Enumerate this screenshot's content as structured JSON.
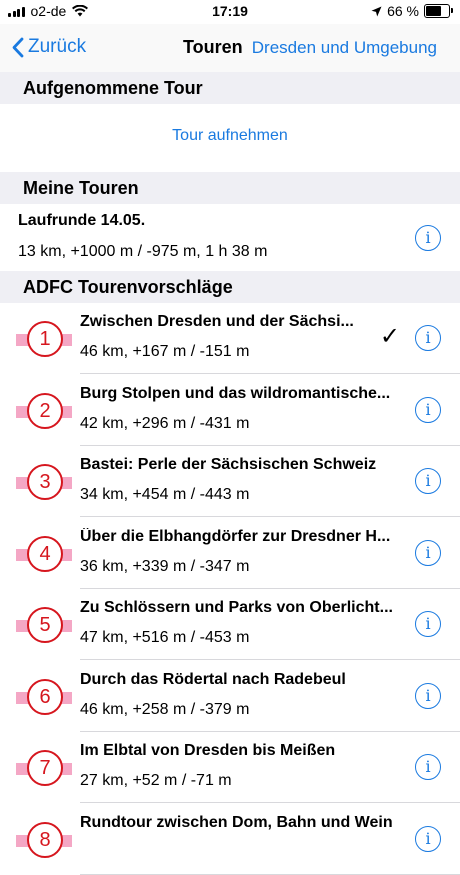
{
  "status_bar": {
    "carrier": "o2-de",
    "time": "17:19",
    "battery_text": "66 %",
    "battery_level": 0.66
  },
  "nav": {
    "back_label": "Zurück",
    "title": "Touren",
    "right_label": "Dresden und Umgebung"
  },
  "recorded_section": {
    "header": "Aufgenommene Tour",
    "record_label": "Tour aufnehmen"
  },
  "my_tours_section": {
    "header": "Meine Touren",
    "tours": [
      {
        "title": "Laufrunde 14.05.",
        "stats": "13 km, +1000 m / -975 m, 1 h 38 m"
      }
    ]
  },
  "adfc_section": {
    "header": "ADFC Tourenvorschläge",
    "tours": [
      {
        "number": "1",
        "title": "Zwischen Dresden und der Sächsi...",
        "stats": "46 km, +167 m / -151 m",
        "checked": true
      },
      {
        "number": "2",
        "title": "Burg Stolpen und das wildromantische...",
        "stats": "42 km, +296 m / -431 m",
        "checked": false
      },
      {
        "number": "3",
        "title": "Bastei: Perle der Sächsischen Schweiz",
        "stats": "34 km, +454 m / -443 m",
        "checked": false
      },
      {
        "number": "4",
        "title": "Über die Elbhangdörfer zur Dresdner H...",
        "stats": "36 km, +339 m / -347 m",
        "checked": false
      },
      {
        "number": "5",
        "title": "Zu Schlössern und Parks von Oberlicht...",
        "stats": "47 km, +516 m / -453 m",
        "checked": false
      },
      {
        "number": "6",
        "title": "Durch das Rödertal nach Radebeul",
        "stats": "46 km, +258 m / -379 m",
        "checked": false
      },
      {
        "number": "7",
        "title": "Im Elbtal von Dresden bis Meißen",
        "stats": "27 km, +52 m / -71 m",
        "checked": false
      },
      {
        "number": "8",
        "title": "Rundtour zwischen Dom, Bahn und Wein",
        "stats": "",
        "checked": false
      }
    ]
  },
  "icons": {
    "info": "info-icon",
    "check": "checkmark-icon",
    "back": "chevron-left-icon"
  },
  "colors": {
    "accent": "#1a7ae0",
    "marker_red": "#d6161e",
    "marker_band": "#f4a7c5",
    "section_bg": "#efeff4"
  }
}
